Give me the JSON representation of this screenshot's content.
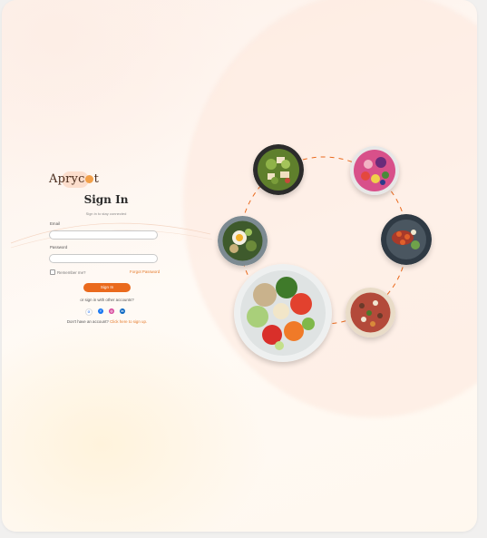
{
  "brand": {
    "logo_text_before": "Apryc",
    "logo_text_after": "t"
  },
  "signin": {
    "title": "Sign In",
    "subtitle": "Sign in to stay connected",
    "email_label": "Email",
    "email_value": "",
    "password_label": "Password",
    "password_value": "",
    "remember_label": "Remember me?",
    "forgot_label": "Forgot Password",
    "button_label": "Sign In",
    "other_accounts": "or sign in with other accounts?",
    "signup_prompt": "Don't have an account?",
    "signup_link": "Click here to sign up."
  },
  "socials": [
    {
      "name": "google-icon",
      "glyph": "G"
    },
    {
      "name": "facebook-icon",
      "glyph": "f"
    },
    {
      "name": "instagram-icon",
      "glyph": "◎"
    },
    {
      "name": "linkedin-icon",
      "glyph": "in"
    }
  ],
  "colors": {
    "accent": "#ea6a1d",
    "link": "#e57a2a"
  },
  "food_images": [
    "salad-bowl",
    "smoothie-bowl",
    "egg-grain-bowl",
    "shrimp-plate",
    "veggie-bowl",
    "pizza"
  ]
}
